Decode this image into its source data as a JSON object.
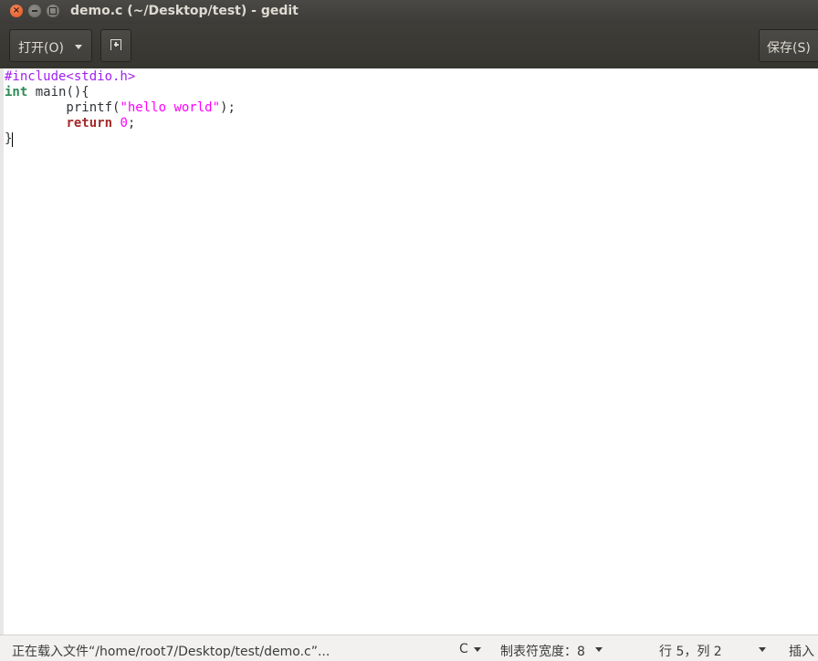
{
  "window": {
    "title": "demo.c (~/Desktop/test) - gedit",
    "controls": {
      "close": "×"
    }
  },
  "toolbar": {
    "open_label": "打开(O)",
    "save_label": "保存(S)"
  },
  "editor": {
    "lines": [
      [
        {
          "cls": "pp",
          "text": "#include<stdio.h>"
        }
      ],
      [
        {
          "cls": "kw-type",
          "text": "int"
        },
        {
          "cls": "",
          "text": " main(){"
        }
      ],
      [
        {
          "cls": "",
          "text": "        printf("
        },
        {
          "cls": "str",
          "text": "\"hello world\""
        },
        {
          "cls": "",
          "text": ");"
        }
      ],
      [
        {
          "cls": "",
          "text": "        "
        },
        {
          "cls": "kw",
          "text": "return"
        },
        {
          "cls": "",
          "text": " "
        },
        {
          "cls": "num",
          "text": "0"
        },
        {
          "cls": "",
          "text": ";"
        }
      ],
      [
        {
          "cls": "",
          "text": "}"
        },
        {
          "cls": "cursor",
          "text": ""
        }
      ]
    ]
  },
  "statusbar": {
    "message": "正在载入文件“/home/root7/Desktop/test/demo.c”...",
    "language": "C",
    "tab_width": "制表符宽度：8",
    "position": "行 5，列 2",
    "insert_mode": "插入"
  }
}
